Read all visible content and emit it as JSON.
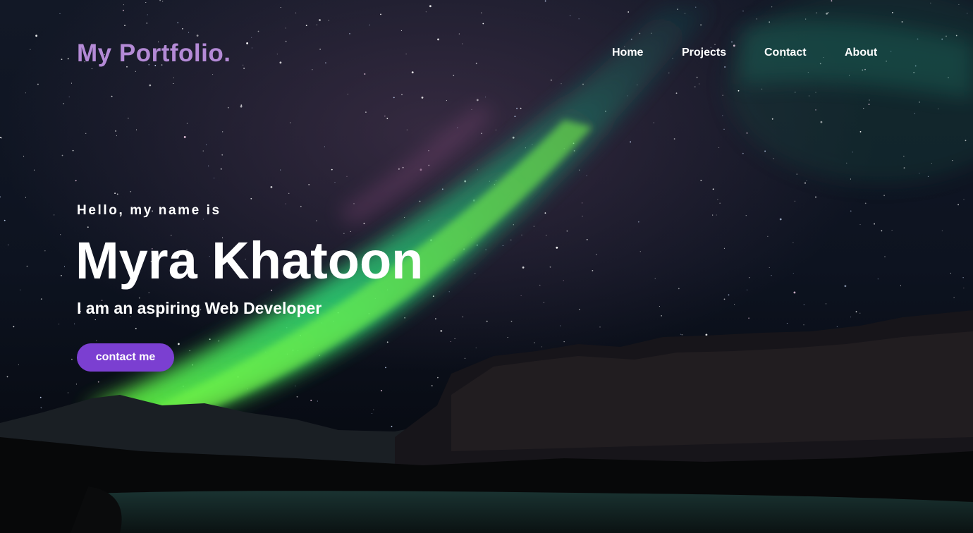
{
  "brand": {
    "logo_text": "My Portfolio.",
    "logo_color": "#b48ad6"
  },
  "nav": {
    "items": [
      {
        "label": "Home"
      },
      {
        "label": "Projects"
      },
      {
        "label": "Contact"
      },
      {
        "label": "About"
      }
    ]
  },
  "hero": {
    "greeting": "Hello, my name is",
    "name": "Myra Khatoon",
    "tagline": "I am an aspiring Web Developer",
    "cta_label": "contact me",
    "cta_color": "#7b3fd1",
    "background": "night-sky-aurora-mountains"
  }
}
